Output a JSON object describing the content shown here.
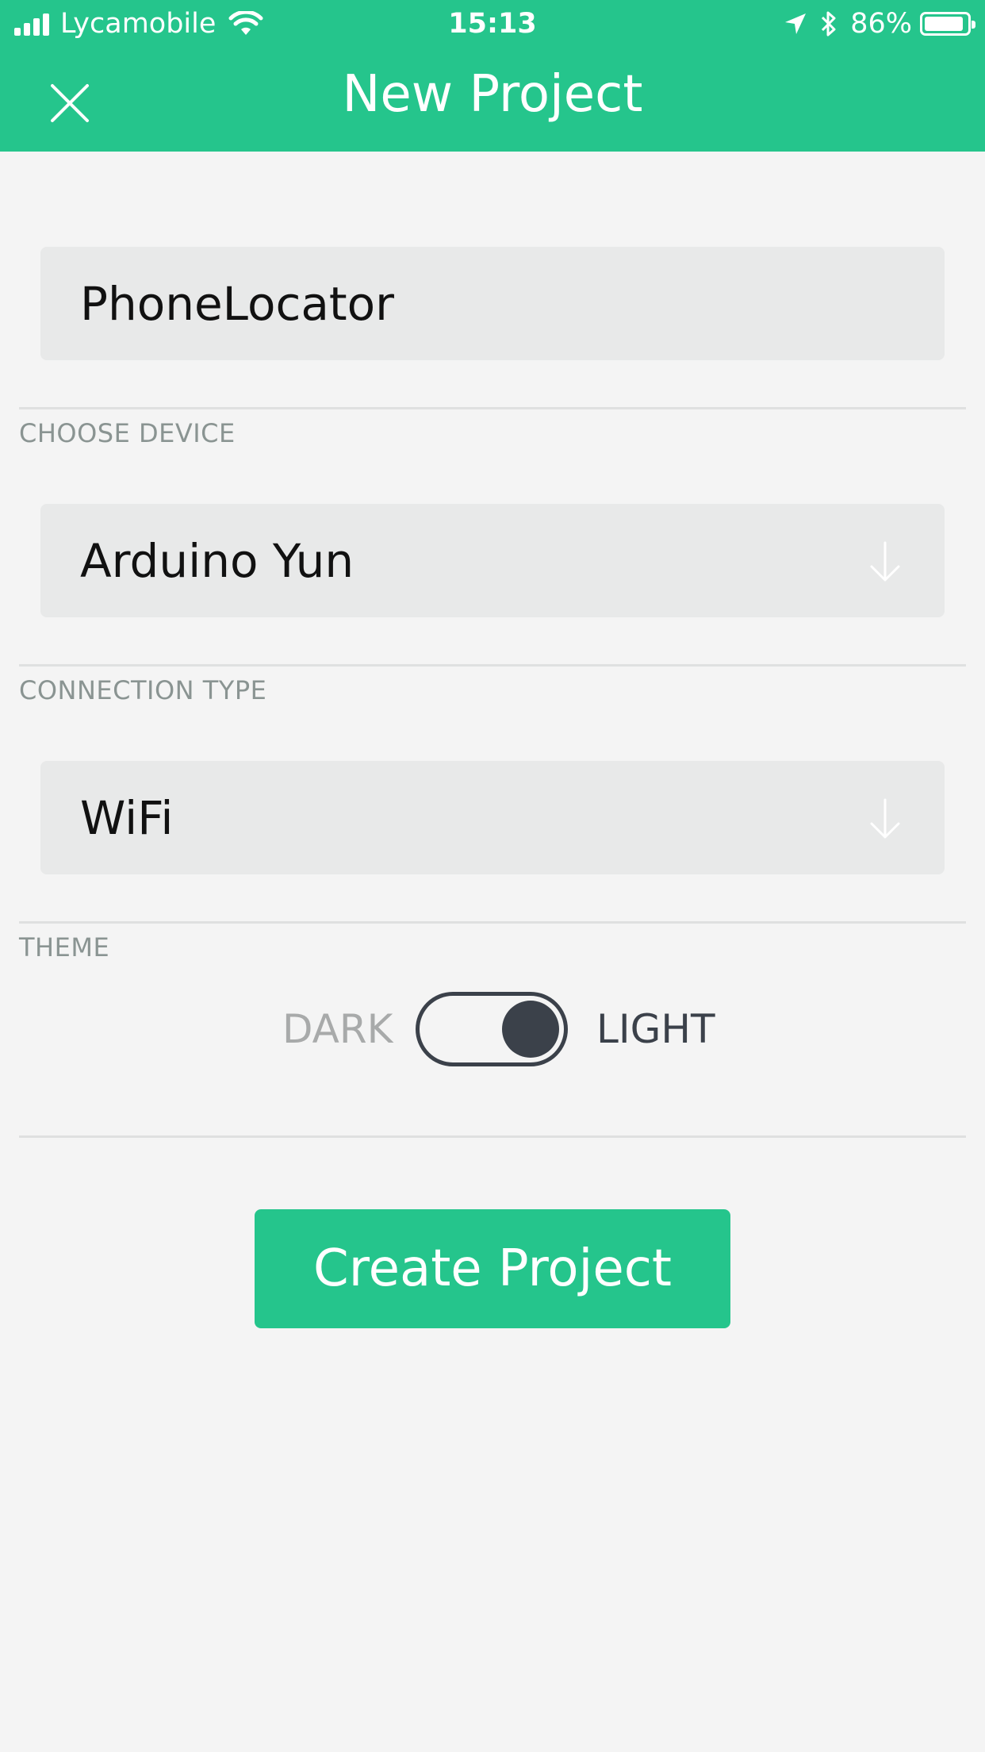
{
  "status_bar": {
    "carrier": "Lycamobile",
    "time": "15:13",
    "battery": "86%",
    "battery_level": 0.86,
    "icons": [
      "signal-icon",
      "wifi-icon",
      "location-arrow-icon",
      "bluetooth-icon",
      "battery-icon"
    ]
  },
  "header": {
    "title": "New Project",
    "close_icon": "close-icon"
  },
  "form": {
    "project_name": "PhoneLocator",
    "device_label": "CHOOSE DEVICE",
    "device_value": "Arduino Yun",
    "connection_label": "CONNECTION TYPE",
    "connection_value": "WiFi",
    "dropdown_icon": "arrow-down-icon",
    "theme_label": "THEME",
    "theme_dark": "DARK",
    "theme_light": "LIGHT",
    "theme_selected": "LIGHT"
  },
  "actions": {
    "create_label": "Create Project"
  },
  "colors": {
    "accent": "#25c58c",
    "background": "#f4f4f4",
    "field_background": "#e8e9e9",
    "label_gray": "#8a9492",
    "toggle_dark": "#3b414a"
  }
}
